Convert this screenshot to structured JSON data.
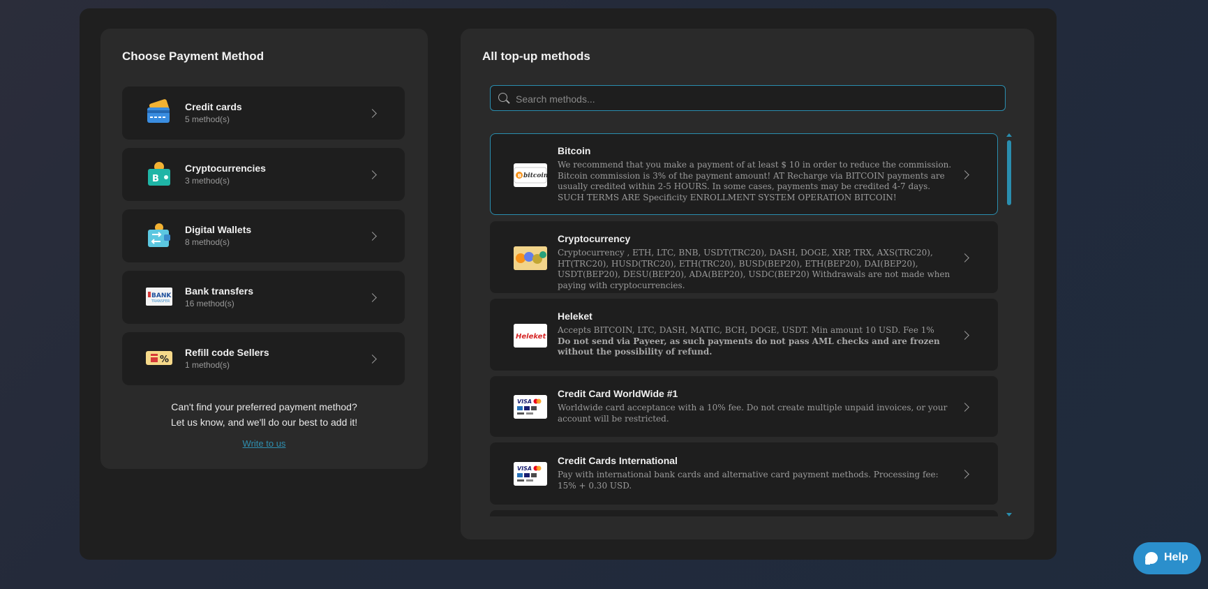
{
  "left_panel": {
    "title": "Choose Payment Method",
    "categories": [
      {
        "name": "Credit cards",
        "count": "5 method(s)",
        "icon": "credit-card-icon"
      },
      {
        "name": "Cryptocurrencies",
        "count": "3 method(s)",
        "icon": "crypto-wallet-icon"
      },
      {
        "name": "Digital Wallets",
        "count": "8 method(s)",
        "icon": "digital-wallet-icon"
      },
      {
        "name": "Bank transfers",
        "count": "16 method(s)",
        "icon": "bank-transfer-icon"
      },
      {
        "name": "Refill code Sellers",
        "count": "1 method(s)",
        "icon": "refill-code-icon"
      }
    ],
    "help_line1": "Can't find your preferred payment method?",
    "help_line2": "Let us know, and we'll do our best to add it!",
    "write_link": "Write to us"
  },
  "right_panel": {
    "title": "All top-up methods",
    "search_placeholder": "Search methods...",
    "methods": [
      {
        "name": "Bitcoin",
        "desc": "We recommend that you make a payment of at least $ 10 in order to reduce the commission. Bitcoin commission is 3% of the payment amount! AT Recharge via BITCOIN payments are usually credited within 2-5 HOURS. In some cases, payments may be credited 4-7 days. SUCH TERMS ARE Specificity ENROLLMENT SYSTEM OPERATION BITCOIN!",
        "logo_text": "bitcoin"
      },
      {
        "name": "Cryptocurrency",
        "desc": "Cryptocurrency , ETH, LTC, BNB, USDT(TRC20), DASH, DOGE, XRP, TRX, AXS(TRC20), HT(TRC20), HUSD(TRC20), ETH(TRC20), BUSD(BEP20), ETH(BEP20), DAI(BEP20), USDT(BEP20), DESU(BEP20), ADA(BEP20), USDC(BEP20) Withdrawals are not made when paying with cryptocurrencies."
      },
      {
        "name": "Heleket",
        "desc": "Accepts BITCOIN, LTC, DASH, MATIC, BCH, DOGE, USDT. Min amount 10 USD. Fee 1%",
        "desc_bold": "Do not send via Payeer, as such payments do not pass AML checks and are frozen without the possibility of refund.",
        "logo_text": "Heleket"
      },
      {
        "name": "Credit Card WorldWide #1",
        "desc": "Worldwide card acceptance with a 10% fee. Do not create multiple unpaid invoices, or your account will be restricted."
      },
      {
        "name": "Credit Cards International",
        "desc": "Pay with international bank cards and alternative card payment methods. Processing fee: 15% + 0.30 USD."
      }
    ]
  },
  "help_button": {
    "label": "Help"
  },
  "colors": {
    "accent": "#2a8eaf",
    "help_button": "#2b8fcc",
    "card_bg": "#1e1e1e",
    "panel_bg": "#2a2a2a"
  }
}
